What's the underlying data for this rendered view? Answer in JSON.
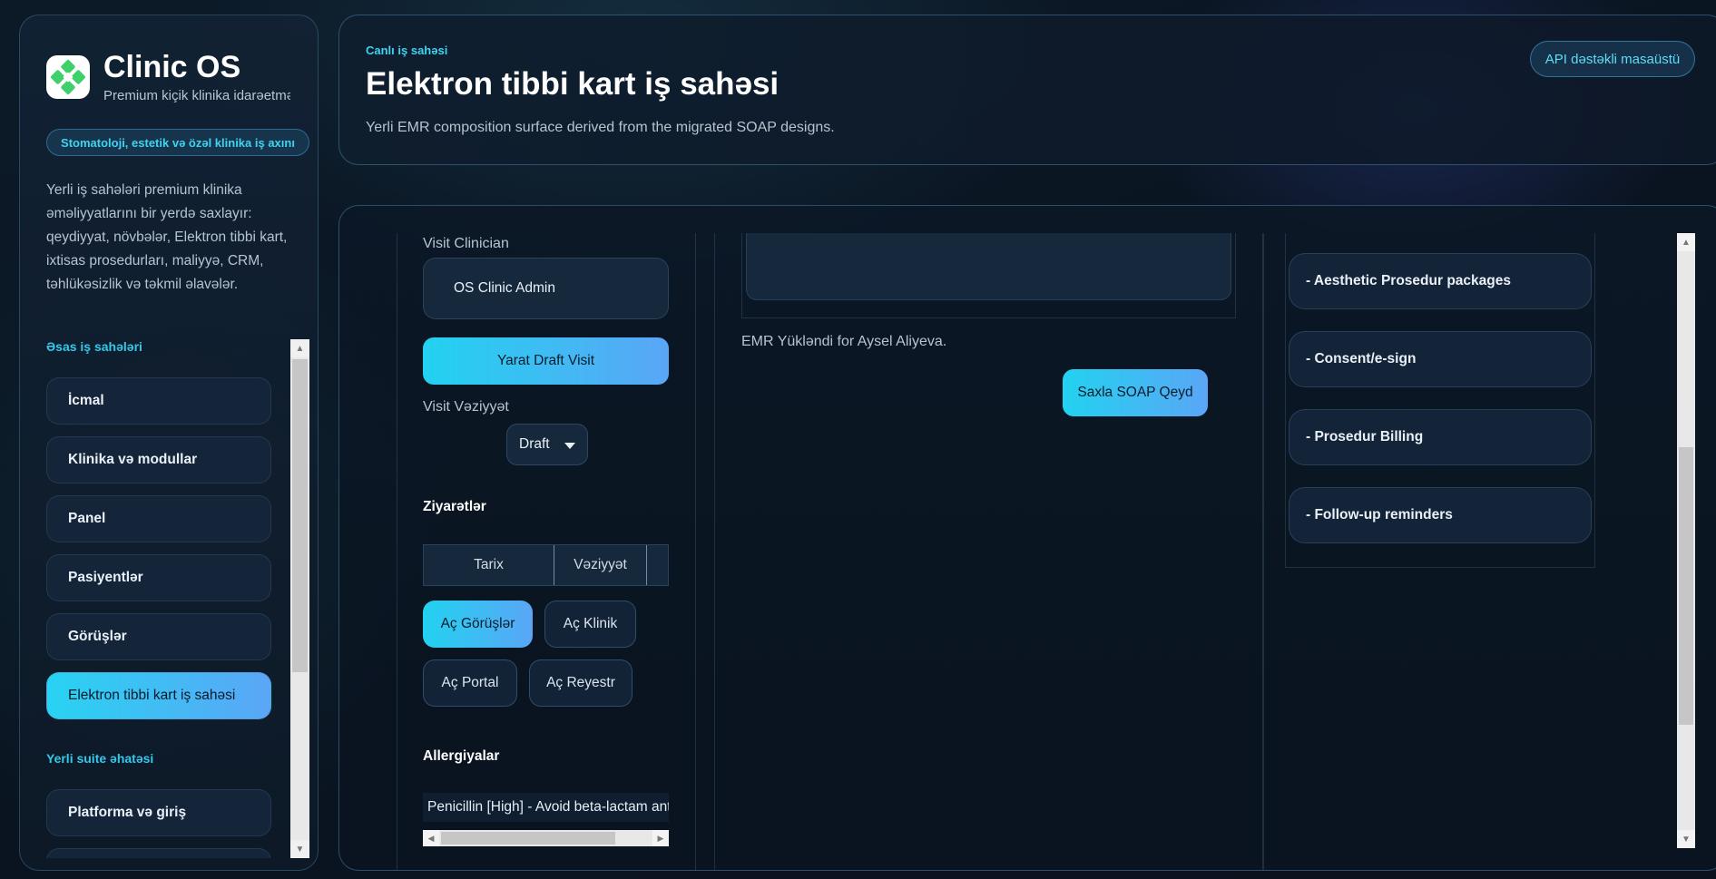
{
  "brand": {
    "title": "Clinic OS",
    "subtitle": "Premium kiçik klinika idarəetmə",
    "scope_pill": "Stomatoloji, estetik və özəl klinika iş axını",
    "description": "Yerli iş sahələri premium klinika əməliyyatlarını bir yerdə saxlayır: qeydiyyat, növbələr, Elektron tibbi kart, ixtisas prosedurları, maliyyə, CRM, təhlükəsizlik və təkmil əlavələr."
  },
  "sidebar": {
    "section_main": "Əsas iş sahələri",
    "items": [
      {
        "label": "İcmal"
      },
      {
        "label": "Klinika və modullar"
      },
      {
        "label": "Panel"
      },
      {
        "label": "Pasiyentlər"
      },
      {
        "label": "Görüşlər"
      },
      {
        "label": "Elektron tibbi kart iş sahəsi",
        "active": true
      }
    ],
    "section_suite": "Yerli suite əhatəsi",
    "suite_items": [
      {
        "label": "Platforma və giriş"
      }
    ]
  },
  "header": {
    "eyebrow": "Canlı iş sahəsi",
    "title": "Elektron tibbi kart iş sahəsi",
    "subtitle": "Yerli EMR composition surface derived from the migrated SOAP designs.",
    "api_pill": "API dəstəkli masaüstü"
  },
  "visit": {
    "clinician_label": "Visit Clinician",
    "clinician_value": "OS Clinic Admin",
    "create_button": "Yarat Draft Visit",
    "status_label": "Visit Vəziyyət",
    "status_value": "Draft"
  },
  "visits": {
    "heading": "Ziyarətlər",
    "columns": [
      "Tarix",
      "Vəziyyət"
    ],
    "buttons": [
      {
        "label": "Aç Görüşlər",
        "active": true
      },
      {
        "label": "Aç Klinik"
      },
      {
        "label": "Aç Portal"
      },
      {
        "label": "Aç Reyestr"
      }
    ]
  },
  "allergies": {
    "heading": "Allergiyalar",
    "entry": "Penicillin [High] - Avoid beta-lactam antibiotics"
  },
  "soap": {
    "status_text": "EMR Yükləndi for Aysel Aliyeva.",
    "save_button": "Saxla SOAP Qeyd"
  },
  "modules": {
    "items": [
      "- Aesthetic Prosedur packages",
      "- Consent/e-sign",
      "- Prosedur Billing",
      "- Follow-up reminders"
    ]
  },
  "colors": {
    "accent": "#22d2f0",
    "accent_end": "#5aa6f6",
    "background": "#0a1422"
  }
}
